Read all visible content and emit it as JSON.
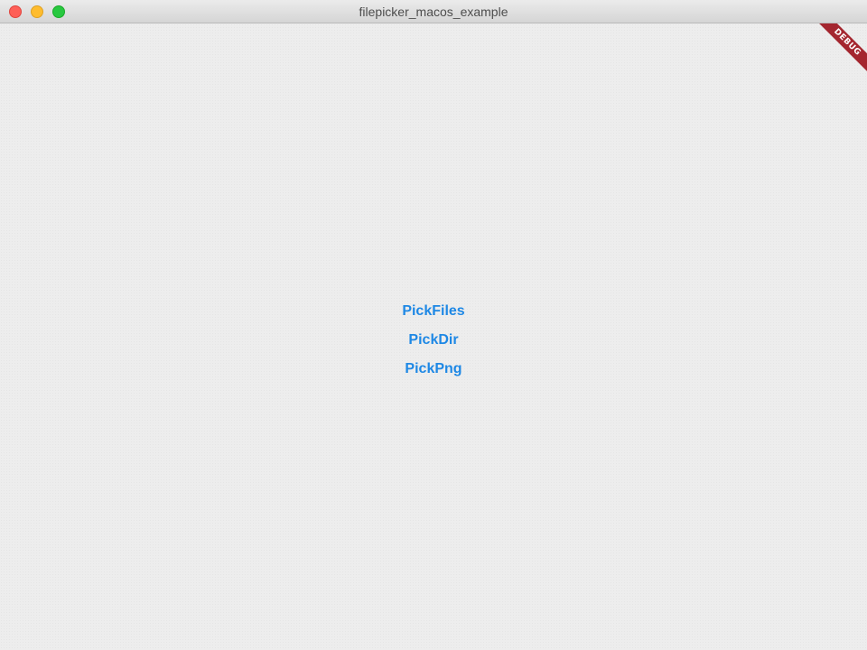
{
  "window": {
    "title": "filepicker_macos_example"
  },
  "banner": {
    "label": "DEBUG"
  },
  "buttons": [
    {
      "label": "PickFiles"
    },
    {
      "label": "PickDir"
    },
    {
      "label": "PickPng"
    }
  ],
  "colors": {
    "accent": "#1e88e5",
    "banner": "#a4262f"
  }
}
